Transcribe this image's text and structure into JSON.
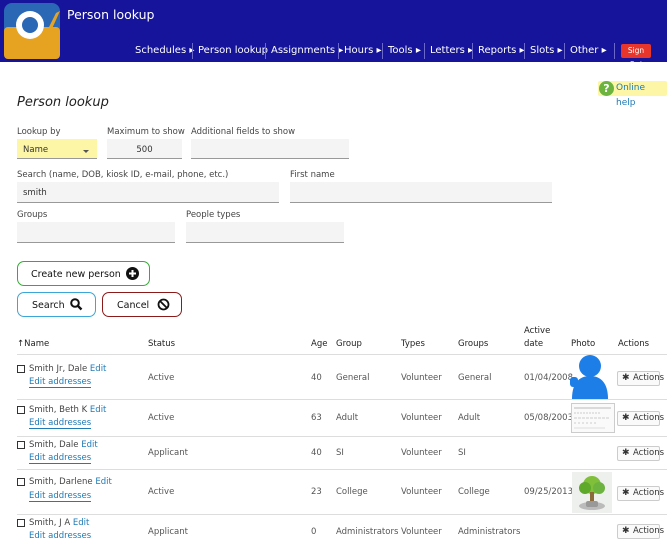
{
  "app": {
    "title": "Person lookup",
    "nav": [
      {
        "label": "Schedules ▸"
      },
      {
        "label": "Person lookup"
      },
      {
        "label": "Assignments ▸"
      },
      {
        "label": "Hours ▸"
      },
      {
        "label": "Tools ▸"
      },
      {
        "label": "Letters ▸"
      },
      {
        "label": "Reports ▸"
      },
      {
        "label": "Slots ▸"
      },
      {
        "label": "Other ▸"
      }
    ],
    "signout_label": "Sign Out",
    "colors": {
      "header": "#16149a",
      "signout": "#e8362c",
      "link": "#1f7ab6"
    }
  },
  "help": {
    "icon": "question-icon",
    "label": "Online help"
  },
  "page": {
    "title": "Person lookup"
  },
  "form": {
    "lookup_by": {
      "label": "Lookup by",
      "value": "Name"
    },
    "max_show": {
      "label": "Maximum to show",
      "value": "500"
    },
    "additional": {
      "label": "Additional fields to show",
      "value": ""
    },
    "search": {
      "label": "Search (name, DOB, kiosk ID, e-mail, phone, etc.)",
      "value": "smith"
    },
    "first_name": {
      "label": "First name",
      "value": ""
    },
    "groups": {
      "label": "Groups",
      "value": ""
    },
    "people_types": {
      "label": "People types",
      "value": ""
    }
  },
  "buttons": {
    "create": {
      "label": "Create new person",
      "icon": "plus-circle-icon"
    },
    "search": {
      "label": "Search",
      "icon": "magnifier-icon"
    },
    "cancel": {
      "label": "Cancel",
      "icon": "ban-icon"
    }
  },
  "table": {
    "sort_indicator": "↑",
    "headers": {
      "name": "Name",
      "status": "Status",
      "age": "Age",
      "group": "Group",
      "types": "Types",
      "groups": "Groups",
      "active_date_1": "Active",
      "active_date_2": "date",
      "photo": "Photo",
      "actions": "Actions"
    },
    "edit_label": "Edit",
    "edit_addresses_label": "Edit addresses",
    "actions_label": "Actions",
    "rows": [
      {
        "name": "Smith Jr, Dale",
        "status": "Active",
        "age": "40",
        "group": "General",
        "types": "Volunteer",
        "groups": "General",
        "active_date": "01/04/2008",
        "photo": "person-silhouette"
      },
      {
        "name": "Smith, Beth K",
        "status": "Active",
        "age": "63",
        "group": "Adult",
        "types": "Volunteer",
        "groups": "Adult",
        "active_date": "05/08/2003",
        "photo": "document-thumbnail"
      },
      {
        "name": "Smith, Dale",
        "status": "Applicant",
        "age": "40",
        "group": "SI",
        "types": "Volunteer",
        "groups": "SI",
        "active_date": "",
        "photo": ""
      },
      {
        "name": "Smith, Darlene",
        "status": "Active",
        "age": "23",
        "group": "College",
        "types": "Volunteer",
        "groups": "College",
        "active_date": "09/25/2013",
        "photo": "tree-thumbnail"
      },
      {
        "name": "Smith, J A",
        "status": "Applicant",
        "age": "0",
        "group": "Administrators",
        "types": "Volunteer",
        "groups": "Administrators",
        "active_date": "",
        "photo": ""
      }
    ]
  }
}
